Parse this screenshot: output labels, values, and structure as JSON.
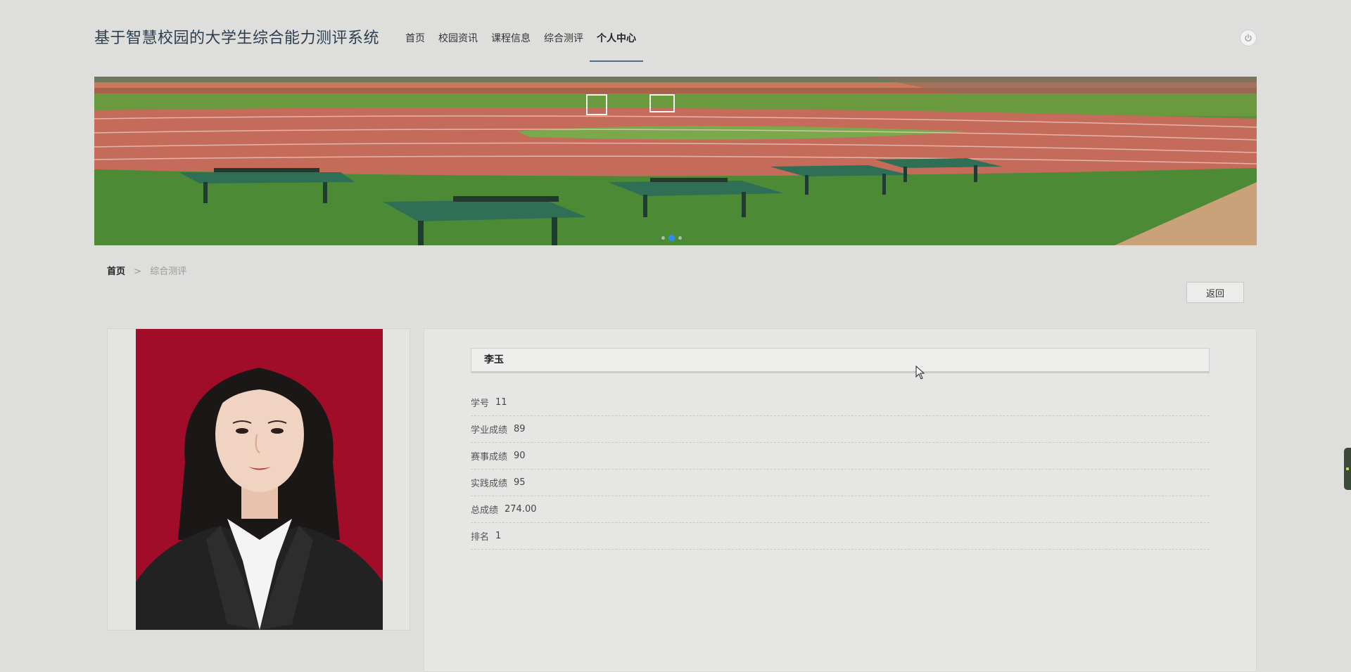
{
  "site": {
    "title": "基于智慧校园的大学生综合能力测评系统"
  },
  "nav": {
    "items": [
      {
        "label": "首页"
      },
      {
        "label": "校园资讯"
      },
      {
        "label": "课程信息"
      },
      {
        "label": "综合测评"
      },
      {
        "label": "个人中心",
        "active": true
      }
    ],
    "power_icon": "power-icon"
  },
  "banner": {
    "slides": 3,
    "active_slide": 2,
    "active_dot_color": "#2d8cf0"
  },
  "breadcrumb": {
    "home": "首页",
    "separator": ">",
    "current": "综合测评"
  },
  "back_button": {
    "label": "返回"
  },
  "profile": {
    "name": "李玉",
    "fields": [
      {
        "label": "学号",
        "value": "11"
      },
      {
        "label": "学业成绩",
        "value": "89"
      },
      {
        "label": "赛事成绩",
        "value": "90"
      },
      {
        "label": "实践成绩",
        "value": "95"
      },
      {
        "label": "总成绩",
        "value": "274.00"
      },
      {
        "label": "排名",
        "value": "1"
      }
    ]
  },
  "colors": {
    "accent": "#4a6f8a",
    "photo_background": "#a10d29"
  }
}
